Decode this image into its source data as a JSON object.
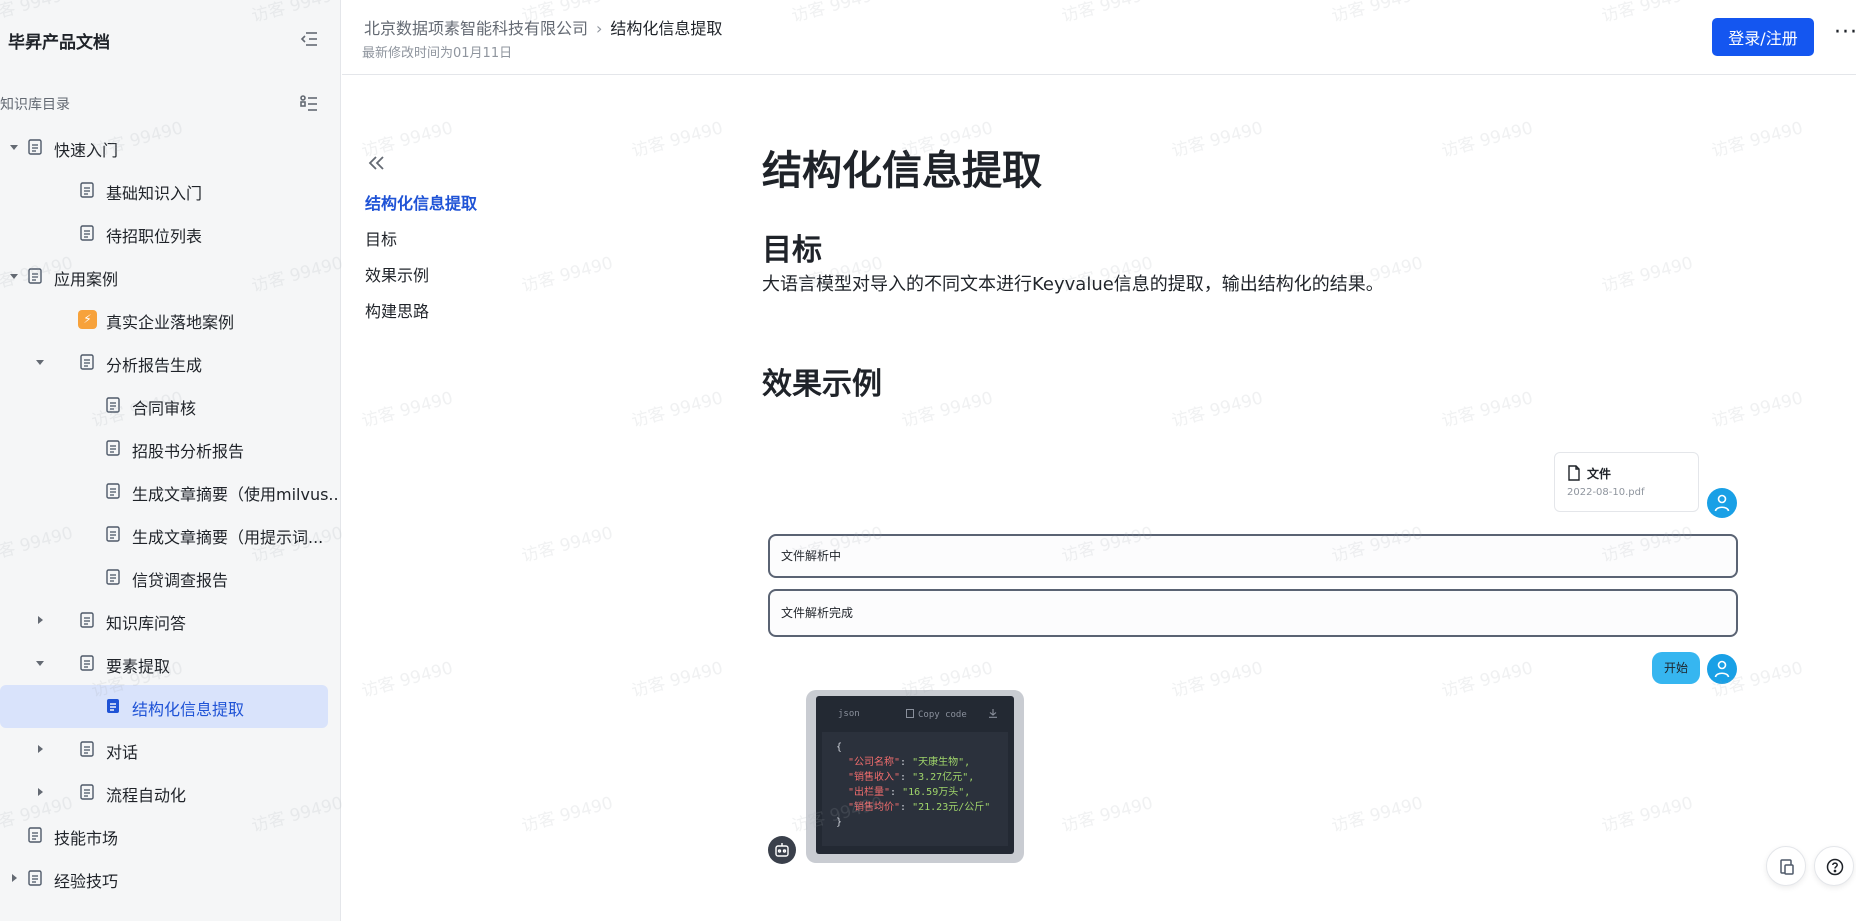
{
  "sidebar": {
    "title": "毕昇产品文档",
    "directory_label": "知识库目录",
    "tree": [
      {
        "label": "快速入门",
        "depth": 0,
        "caret": "down",
        "icon": "doc-icon"
      },
      {
        "label": "基础知识入门",
        "depth": 1,
        "caret": "none",
        "icon": "doc-icon"
      },
      {
        "label": "待招职位列表",
        "depth": 1,
        "caret": "none",
        "icon": "doc-icon"
      },
      {
        "label": "应用案例",
        "depth": 0,
        "caret": "down",
        "icon": "doc-icon"
      },
      {
        "label": "真实企业落地案例",
        "depth": 1,
        "caret": "none",
        "icon": "lightning-badge-icon"
      },
      {
        "label": "分析报告生成",
        "depth": 1,
        "caret": "down",
        "icon": "doc-icon"
      },
      {
        "label": "合同审核",
        "depth": 2,
        "caret": "none",
        "icon": "doc-icon"
      },
      {
        "label": "招股书分析报告",
        "depth": 2,
        "caret": "none",
        "icon": "doc-icon"
      },
      {
        "label": "生成文章摘要（使用milvus...",
        "depth": 2,
        "caret": "none",
        "icon": "doc-icon"
      },
      {
        "label": "生成文章摘要（用提示词...",
        "depth": 2,
        "caret": "none",
        "icon": "doc-icon"
      },
      {
        "label": "信贷调查报告",
        "depth": 2,
        "caret": "none",
        "icon": "doc-icon"
      },
      {
        "label": "知识库问答",
        "depth": 1,
        "caret": "right",
        "icon": "doc-icon"
      },
      {
        "label": "要素提取",
        "depth": 1,
        "caret": "down",
        "icon": "doc-icon"
      },
      {
        "label": "结构化信息提取",
        "depth": 2,
        "caret": "none",
        "icon": "doc-icon",
        "active": true
      },
      {
        "label": "对话",
        "depth": 1,
        "caret": "right",
        "icon": "doc-icon"
      },
      {
        "label": "流程自动化",
        "depth": 1,
        "caret": "right",
        "icon": "doc-icon"
      },
      {
        "label": "技能市场",
        "depth": 0,
        "caret": "none",
        "icon": "doc-icon"
      },
      {
        "label": "经验技巧",
        "depth": 0,
        "caret": "right",
        "icon": "doc-icon"
      }
    ]
  },
  "header": {
    "breadcrumb_parent": "北京数据项素智能科技有限公司",
    "breadcrumb_current": "结构化信息提取",
    "modified": "最新修改时间为01月11日",
    "login_label": "登录/注册",
    "more_label": "···"
  },
  "toc": {
    "items": [
      {
        "label": "结构化信息提取",
        "active": true
      },
      {
        "label": "目标",
        "active": false
      },
      {
        "label": "效果示例",
        "active": false
      },
      {
        "label": "构建思路",
        "active": false
      }
    ]
  },
  "content": {
    "title": "结构化信息提取",
    "goal_heading": "目标",
    "goal_text": "大语言模型对导入的不同文本进行Keyvalue信息的提取，输出结构化的结果。",
    "example_heading": "效果示例"
  },
  "demo": {
    "file_title": "文件",
    "file_name": "2022-08-10.pdf",
    "status_parsing": "文件解析中",
    "status_done": "文件解析完成",
    "start_label": "开始",
    "code_lang": "json",
    "copy_label": "Copy code",
    "code_open": "{",
    "code_close": "}",
    "code_lines": [
      {
        "key": "\"公司名称\"",
        "value": "\"天康生物\","
      },
      {
        "key": "\"销售收入\"",
        "value": "\"3.27亿元\","
      },
      {
        "key": "\"出栏量\"",
        "value": "\"16.59万头\","
      },
      {
        "key": "\"销售均价\"",
        "value": "\"21.23元/公斤\""
      }
    ]
  },
  "watermark": "访客 99490",
  "colors": {
    "accent": "#1456f0",
    "active_bg": "#d9e3fb",
    "active_text": "#1f53d6",
    "avatar_blue": "#19a0e6"
  }
}
